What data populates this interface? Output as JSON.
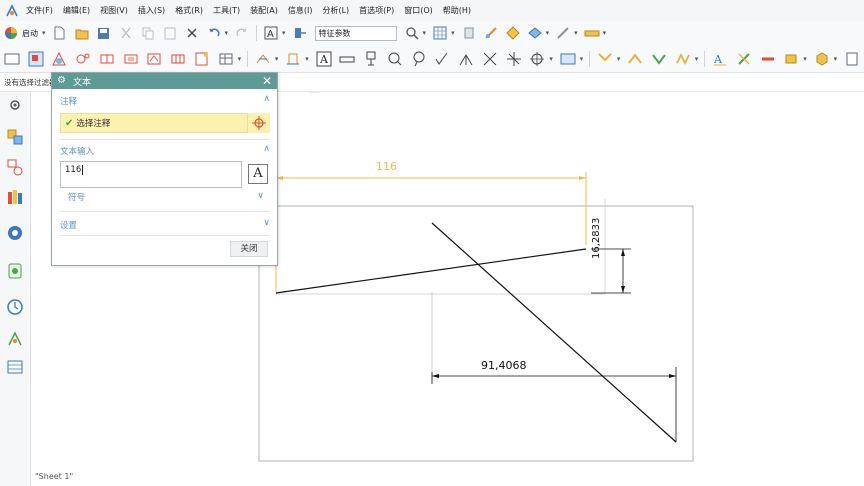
{
  "menubar": {
    "items": [
      "文件(F)",
      "编辑(E)",
      "视图(V)",
      "插入(S)",
      "格式(R)",
      "工具(T)",
      "装配(A)",
      "信息(I)",
      "分析(L)",
      "首选项(P)",
      "窗口(O)",
      "帮助(H)"
    ]
  },
  "toolbar1": {
    "start_label": "启动",
    "feature_combo": "特征参数"
  },
  "selection_bar": {
    "status": "没有选择过滤器"
  },
  "dialog": {
    "title": "文本",
    "section_annotation": "注释",
    "select_annotation": "选择注释",
    "section_text_input": "文本输入",
    "text_value": "116",
    "symbol_label": "符号",
    "section_settings": "设置",
    "close_label": "关闭"
  },
  "drawing": {
    "dim_horizontal_top": "116",
    "dim_vertical": "16,2833",
    "dim_horizontal_bottom": "91,4068",
    "sheet_tab": "\"Sheet 1\""
  },
  "colors": {
    "dialog_header": "#5e9b95",
    "highlight_dim": "#f0b84a",
    "section_blue": "#5e93c9",
    "selection_yellow": "#fbf1b1"
  }
}
